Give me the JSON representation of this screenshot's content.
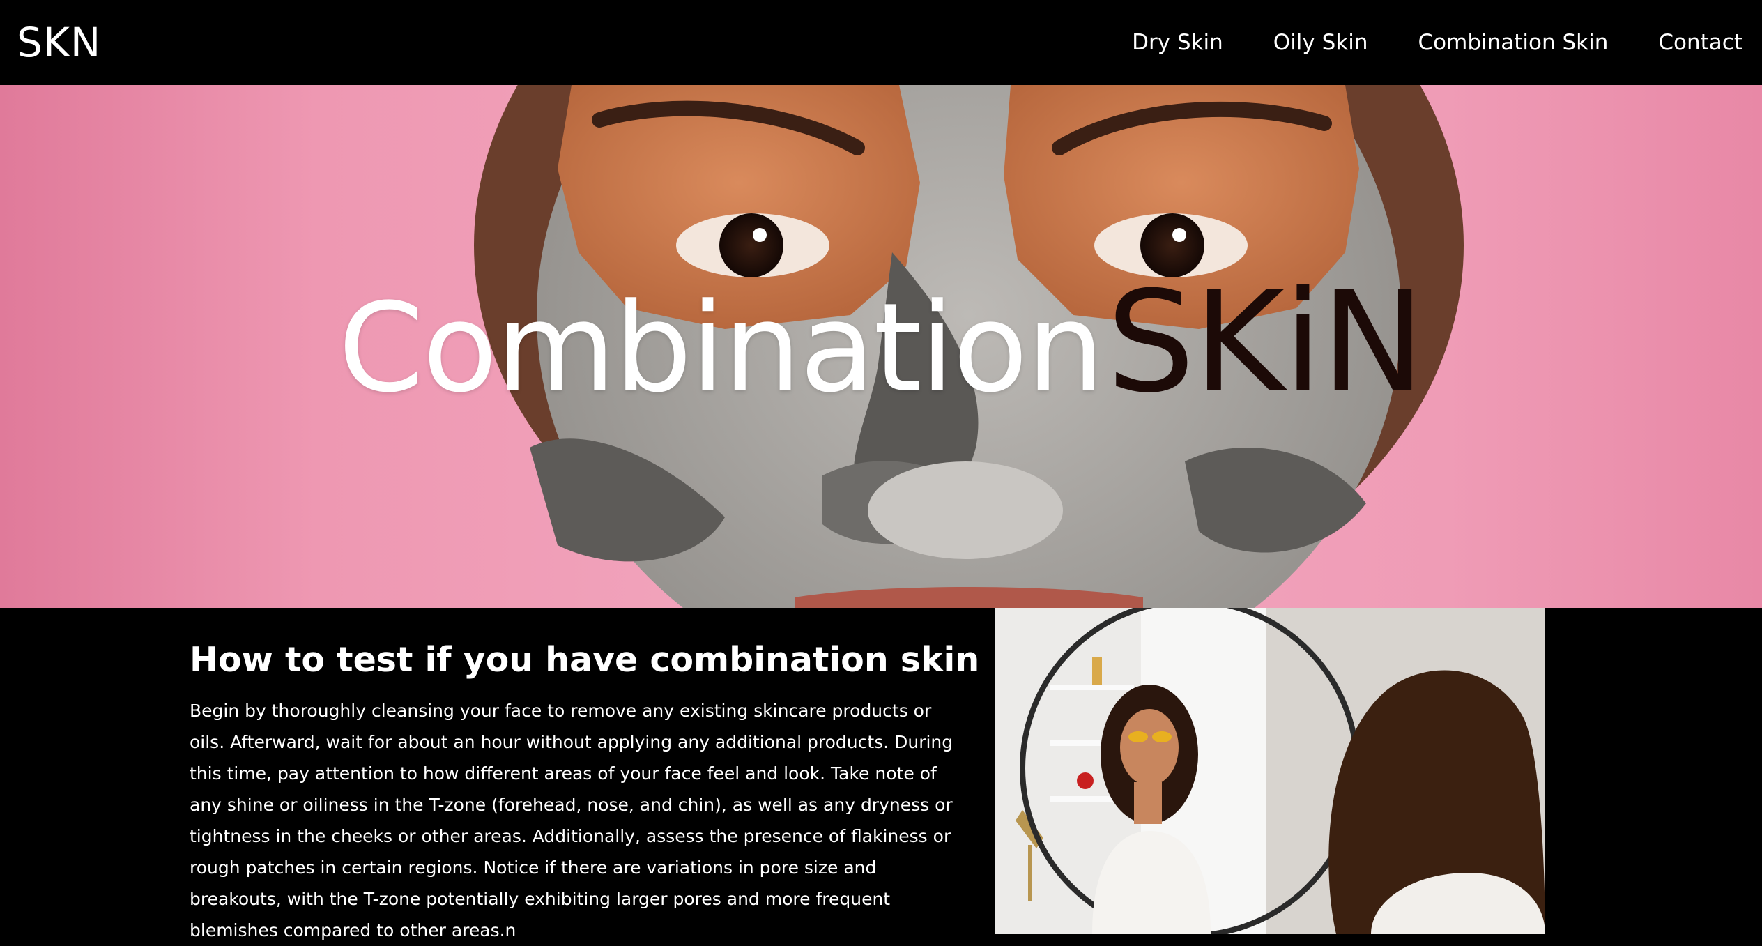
{
  "brand": {
    "logo_text": "SKN"
  },
  "nav": {
    "items": [
      {
        "label": "Dry Skin"
      },
      {
        "label": "Oily Skin"
      },
      {
        "label": "Combination Skin"
      },
      {
        "label": "Contact"
      }
    ]
  },
  "hero": {
    "title_part1": "Combination",
    "title_part2": "SKiN",
    "image": "woman with clay face mask on pink background"
  },
  "section": {
    "heading": "How to test if you have combination skin",
    "body": "Begin by thoroughly cleansing your face to remove any existing skincare products or oils. Afterward, wait for about an hour without applying any additional products. During this time, pay attention to how different areas of your face feel and look. Take note of any shine or oiliness in the T-zone (forehead, nose, and chin), as well as any dryness or tightness in the cheeks or other areas. Additionally, assess the presence of flakiness or rough patches in certain regions. Notice if there are variations in pore size and breakouts, with the T-zone potentially exhibiting larger pores and more frequent blemishes compared to other areas.n",
    "image": "woman applying eye patches in front of a round mirror"
  },
  "colors": {
    "nav_bg": "#000000",
    "hero_pink": "#f3a8c0",
    "title_dark": "#1c0a07",
    "text": "#ffffff"
  }
}
